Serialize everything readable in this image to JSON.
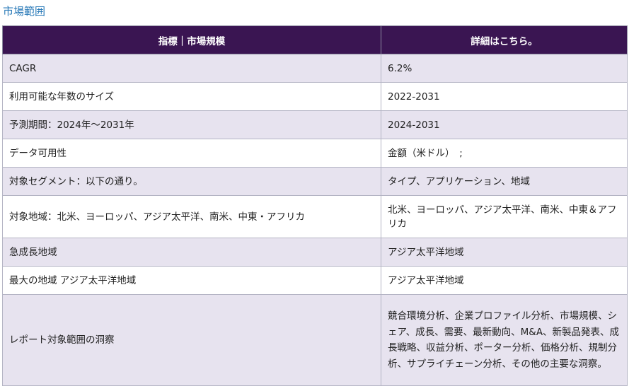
{
  "section": {
    "title": "市場範囲"
  },
  "table": {
    "headers": [
      "指標｜市場規模",
      "詳細はこちら。"
    ],
    "rows": [
      {
        "label": "CAGR",
        "value": "6.2%"
      },
      {
        "label": "利用可能な年数のサイズ",
        "value": "2022-2031"
      },
      {
        "label": "予測期間：2024年～2031年",
        "value": "2024-2031"
      },
      {
        "label": "データ可用性",
        "value": "金額（米ドル）　;"
      },
      {
        "label": "対象セグメント：以下の通り。",
        "value": "タイプ、アプリケーション、地域"
      },
      {
        "label": "対象地域：北米、ヨーロッパ、アジア太平洋、南米、中東・アフリカ",
        "value": "北米、ヨーロッパ、アジア太平洋、南米、中東＆アフリカ"
      },
      {
        "label": "急成長地域",
        "value": "アジア太平洋地域"
      },
      {
        "label": "最大の地域 アジア太平洋地域",
        "value": "アジア太平洋地域"
      },
      {
        "label": "レポート対象範囲の洞察",
        "value": "競合環境分析、企業プロファイル分析、市場規模、シェア、成長、需要、最新動向、M&A、新製品発表、成長戦略、収益分析、ポーター分析、価格分析、規制分析、サプライチェーン分析、その他の主要な洞察。"
      }
    ]
  }
}
